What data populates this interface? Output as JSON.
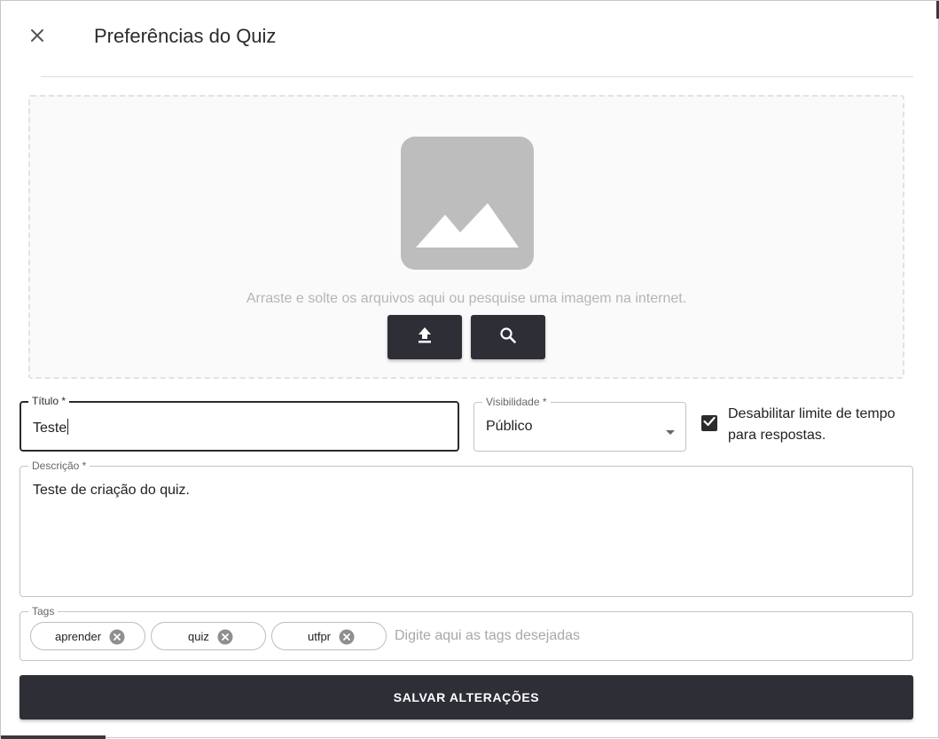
{
  "dialog": {
    "title": "Preferências do Quiz"
  },
  "image_upload": {
    "hint": "Arraste e solte os arquivos aqui ou pesquise uma imagem na internet.",
    "upload_icon": "upload-icon",
    "search_icon": "search-icon"
  },
  "form": {
    "title_label": "Título *",
    "title_value": "Teste",
    "visibility_label": "Visibilidade *",
    "visibility_value": "Público",
    "disable_time_limit_label": "Desabilitar limite de tempo para respostas.",
    "disable_time_limit_checked": true,
    "description_label": "Descrição *",
    "description_value": "Teste de criação do quiz.",
    "tags_label": "Tags",
    "tags": [
      "aprender",
      "quiz",
      "utfpr"
    ],
    "tags_placeholder": "Digite aqui as tags desejadas"
  },
  "actions": {
    "save_label": "SALVAR ALTERAÇÕES"
  },
  "colors": {
    "primary": "#2e2e36",
    "placeholder_image": "#bdbdbd"
  }
}
